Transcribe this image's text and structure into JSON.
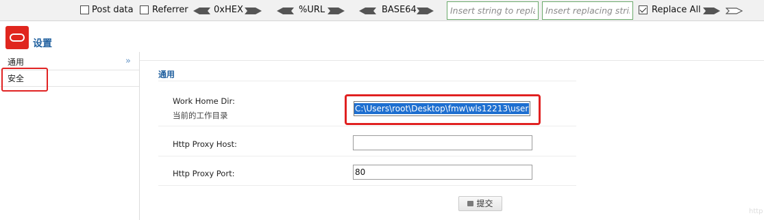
{
  "toolbar": {
    "post_data_label": "Post data",
    "referrer_label": "Referrer",
    "hex_label": "0xHEX",
    "url_label": "%URL",
    "base64_label": "BASE64",
    "replace_search_placeholder": "Insert string to replace",
    "replace_with_placeholder": "Insert replacing string",
    "replace_all_label": "Replace All",
    "post_data_checked": false,
    "referrer_checked": false,
    "replace_all_checked": true
  },
  "header": {
    "logo_icon": "oracle-logo-icon",
    "title": "设置"
  },
  "sidebar": {
    "collapse_icon": "double-chevron-right-icon",
    "items": [
      {
        "label": "通用"
      },
      {
        "label": "安全"
      }
    ]
  },
  "main": {
    "section_title": "通用",
    "fields": [
      {
        "label": "Work Home Dir:",
        "description": "当前的工作目录",
        "value": "C:\\Users\\root\\Desktop\\fmw\\wls12213\\user"
      },
      {
        "label": "Http Proxy Host:",
        "value": ""
      },
      {
        "label": "Http Proxy Port:",
        "value": "80"
      }
    ],
    "submit_label": "提交",
    "submit_icon": "save-icon"
  },
  "colors": {
    "accent": "#1f5f9e",
    "highlight_box": "#e02020",
    "logo": "#e0261e",
    "selection": "#1e6fd0"
  },
  "watermark": "http"
}
